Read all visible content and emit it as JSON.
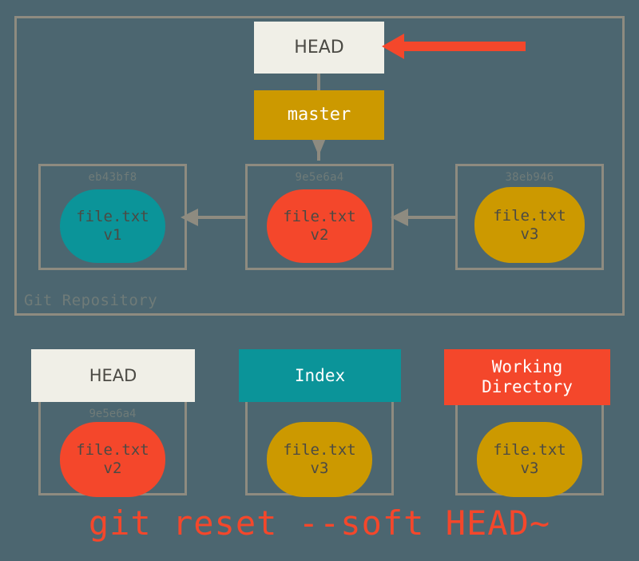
{
  "diagram": {
    "title": "git reset --soft HEAD~",
    "background_color": "#4c6670",
    "border_color": "#8e8b80",
    "colors": {
      "red": "#f4472b",
      "teal": "#0b9499",
      "gold": "#cc9900",
      "cream": "#f0efe7",
      "dark_text": "#4b4a44",
      "muted_text": "#6f7b78"
    }
  },
  "repository": {
    "label": "Git Repository",
    "head": {
      "label": "HEAD"
    },
    "branch": {
      "label": "master"
    },
    "callout": {
      "name": "head-pointer-arrow",
      "color": "#f4472b"
    },
    "commits": [
      {
        "hash": "eb43bf8",
        "file": "file.txt",
        "version": "v1",
        "color": "#0b9499"
      },
      {
        "hash": "9e5e6a4",
        "file": "file.txt",
        "version": "v2",
        "color": "#f4472b"
      },
      {
        "hash": "38eb946",
        "file": "file.txt",
        "version": "v3",
        "color": "#cc9900"
      }
    ]
  },
  "areas": [
    {
      "title": "HEAD",
      "title_line2": "",
      "hash": "9e5e6a4",
      "file": "file.txt",
      "version": "v2",
      "color": "#f4472b",
      "header_color": "#f0efe7"
    },
    {
      "title": "Index",
      "title_line2": "",
      "hash": "",
      "file": "file.txt",
      "version": "v3",
      "color": "#cc9900",
      "header_color": "#0b9499"
    },
    {
      "title": "Working",
      "title_line2": "Directory",
      "hash": "",
      "file": "file.txt",
      "version": "v3",
      "color": "#cc9900",
      "header_color": "#f4472b"
    }
  ],
  "command": {
    "text": "git reset --soft HEAD~"
  }
}
